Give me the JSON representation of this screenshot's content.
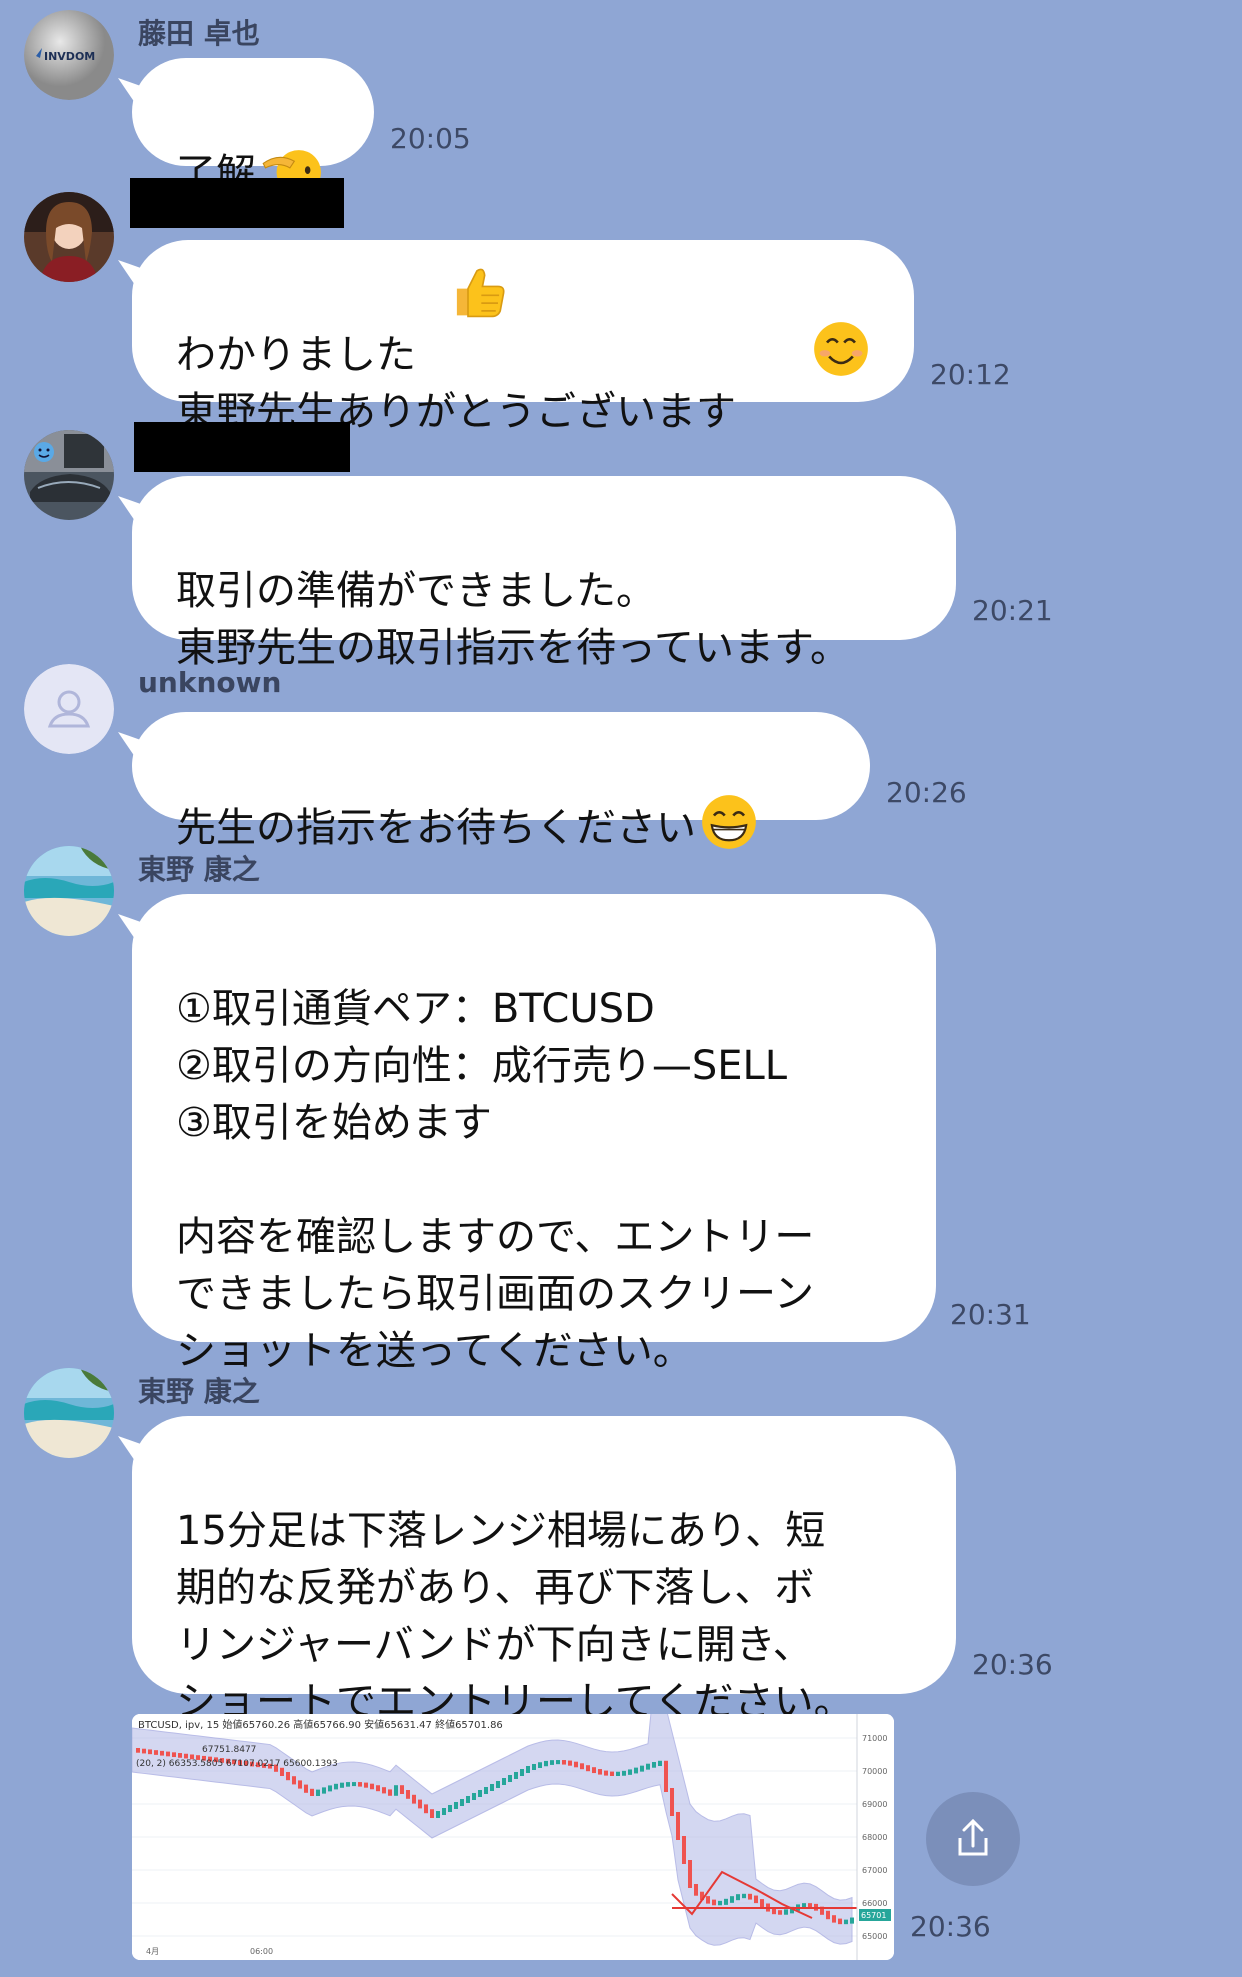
{
  "messages": [
    {
      "sender": "藤田 卓也",
      "text": "了解",
      "time": "20:05",
      "avatar_label": "INVDOM"
    },
    {
      "sender": "",
      "text": "わかりました\n東野先生ありがとうございます",
      "time": "20:12"
    },
    {
      "sender": "",
      "text": "取引の準備ができました。\n東野先生の取引指示を待っています。",
      "time": "20:21"
    },
    {
      "sender": "unknown",
      "text": "先生の指示をお待ちください",
      "time": "20:26"
    },
    {
      "sender": "東野 康之",
      "text": "①取引通貨ペア：BTCUSD\n②取引の方向性：成行売り—SELL\n③取引を始めます\n\n内容を確認しますので、エントリー\nできましたら取引画面のスクリーン\nショットを送ってください。",
      "time": "20:31"
    },
    {
      "sender": "東野 康之",
      "text": "15分足は下落レンジ相場にあり、短\n期的な反発があり、再び下落し、ボ\nリンジャーバンドが下向きに開き、\nショートでエントリーしてください。",
      "time": "20:36"
    },
    {
      "time": "20:36",
      "image": {
        "header": "BTCUSD, ipv, 15  始値65760.26  高値65766.90  安値65631.47  終値65701.86",
        "ma_line": "67751.8477",
        "bb_line": "(20, 2)  66353.5805  67107.0217  65600.1393",
        "price_tag": "65701",
        "y_ticks": [
          "71000",
          "70000",
          "69000",
          "68000",
          "67000",
          "66000",
          "65000"
        ],
        "x_ticks": [
          "4月",
          "06:00"
        ]
      }
    }
  ],
  "colors": {
    "background": "#8fa6d4",
    "bubble": "#ffffff",
    "candle_up": "#26a69a",
    "candle_down": "#ef5350",
    "band": "#b7bde8"
  }
}
